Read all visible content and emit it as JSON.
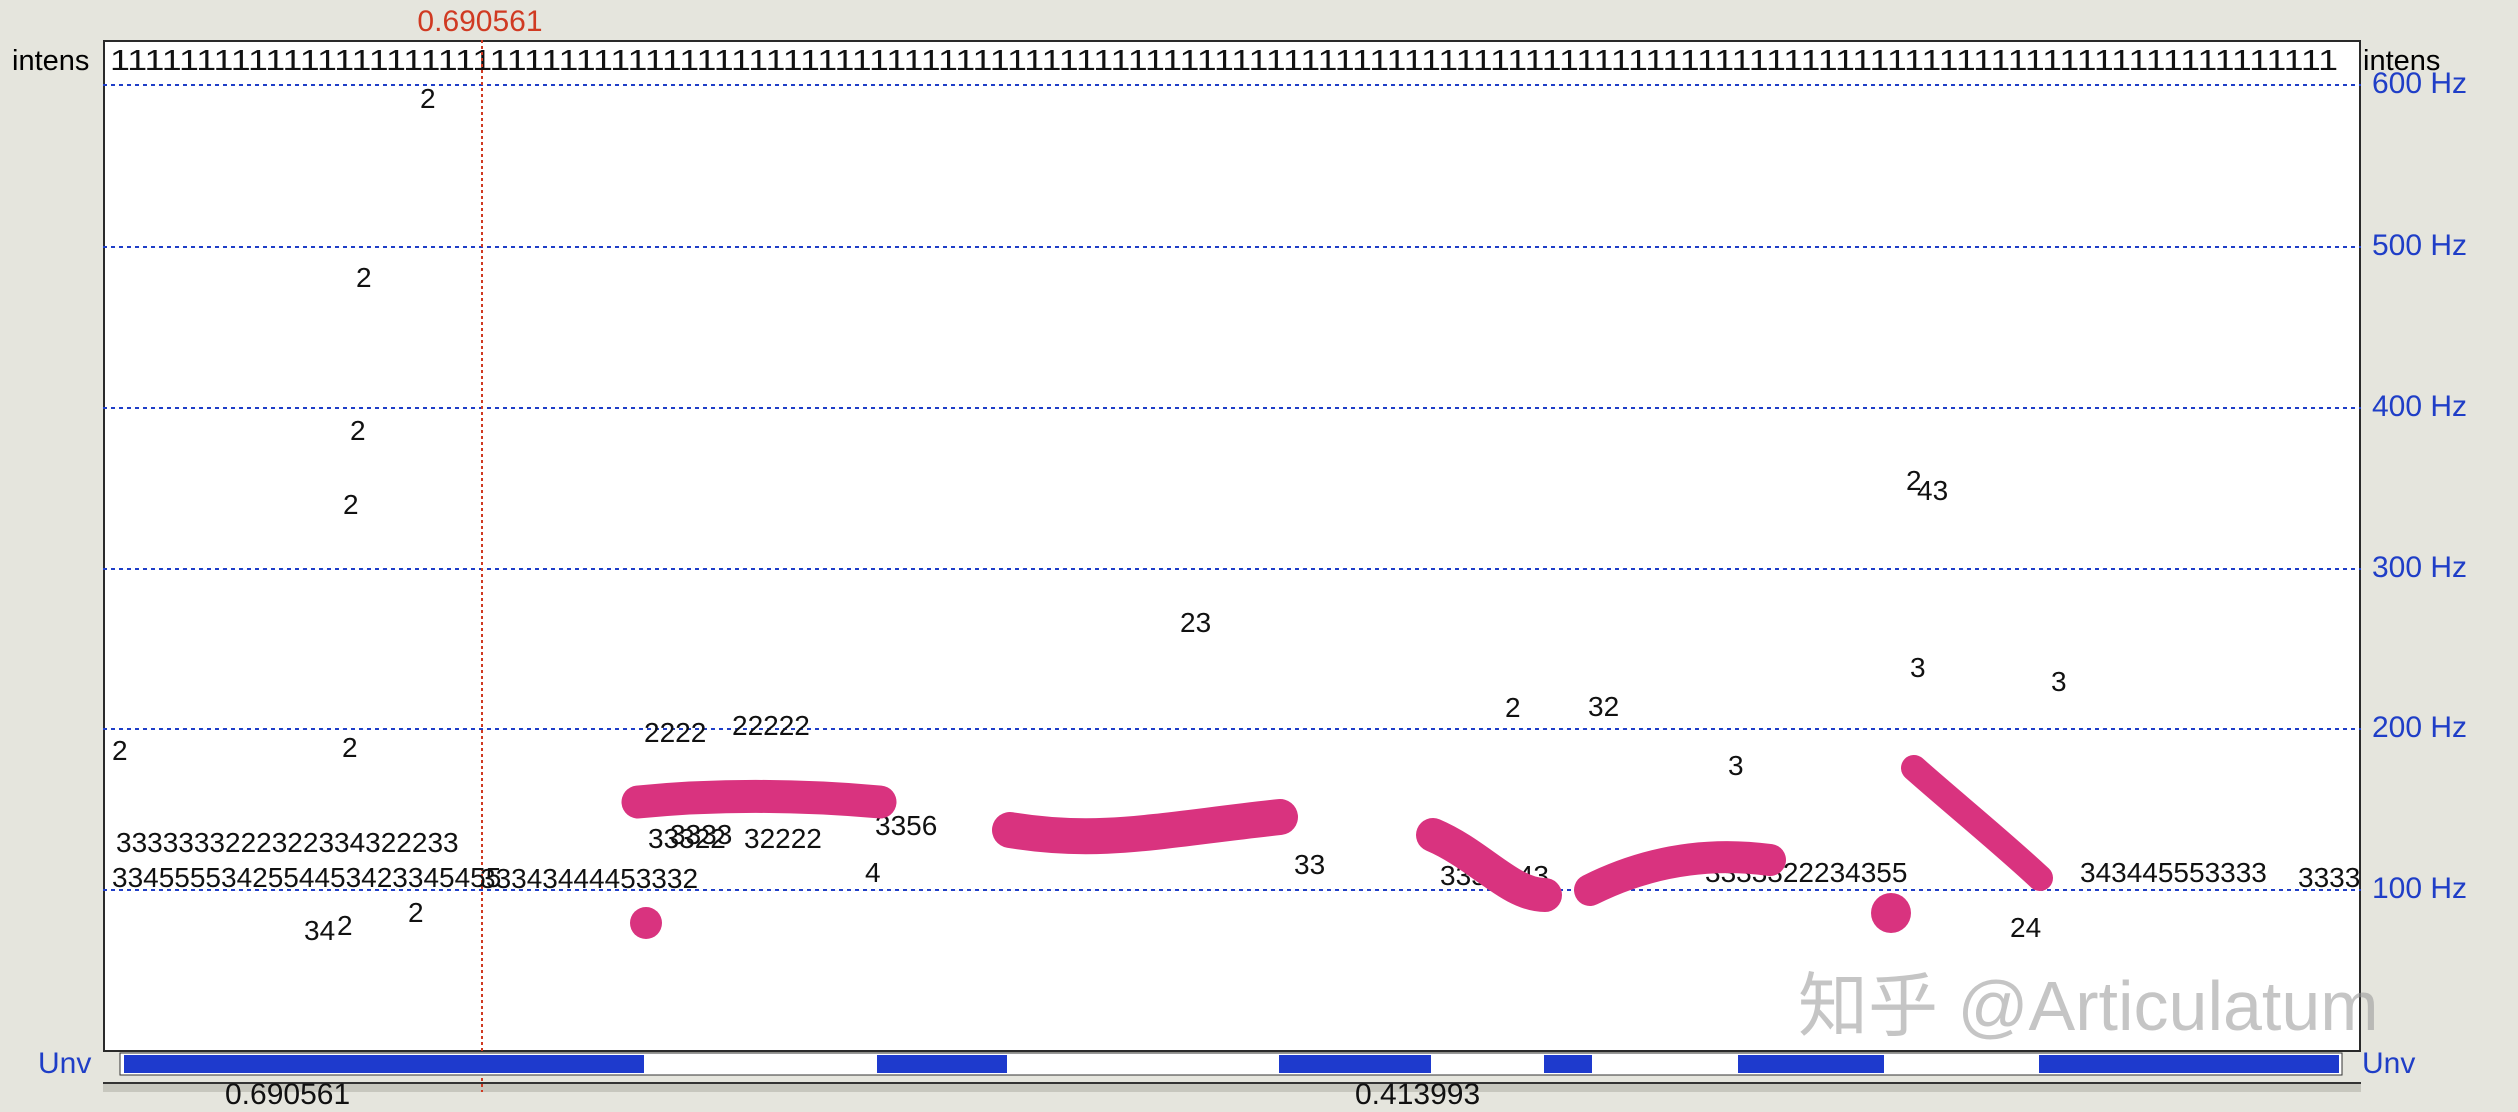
{
  "cursor_time": "0.690561",
  "left_label": "intens",
  "right_label": "intens",
  "frequency_labels": [
    "600 Hz",
    "500 Hz",
    "400 Hz",
    "300 Hz",
    "200 Hz",
    "100 Hz"
  ],
  "voicing_label": "Unv",
  "bottom_values": [
    "0.690561",
    "0.413993"
  ],
  "watermark": "知乎 @Articulatum",
  "colors": {
    "grid": "#1f3ec7",
    "cursor": "#d03a22",
    "pitch": "#d9337f",
    "voicing": "#1e3acd"
  }
}
